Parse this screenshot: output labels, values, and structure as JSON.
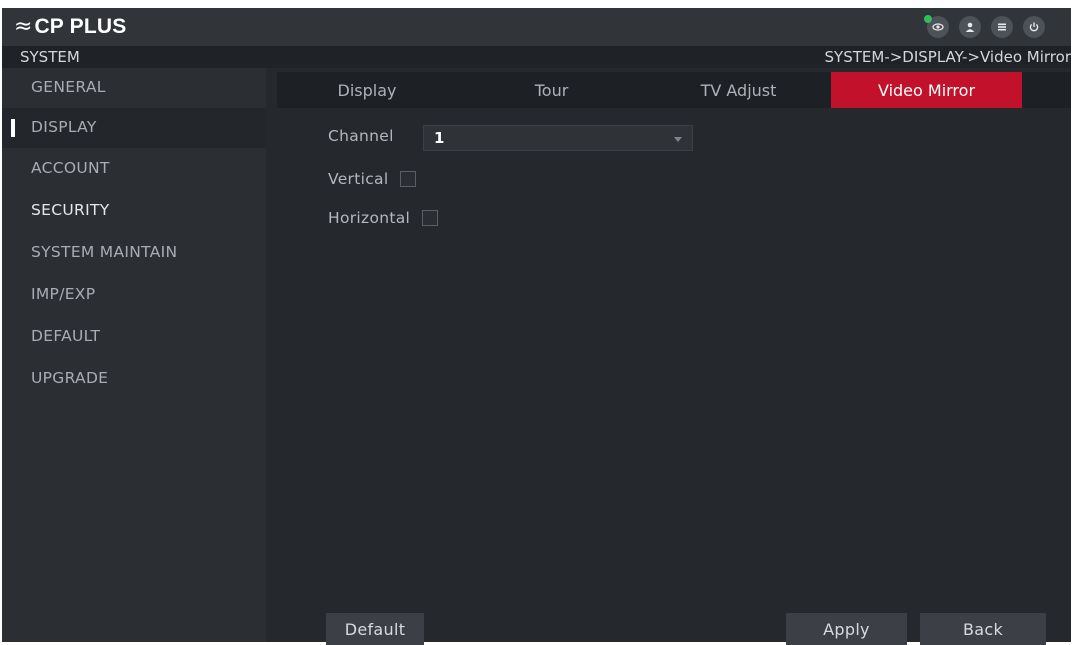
{
  "header": {
    "logo_text": "CP PLUS",
    "icons": [
      "live-view-icon",
      "user-icon",
      "menu-icon",
      "power-icon"
    ]
  },
  "pathbar": {
    "section": "SYSTEM",
    "breadcrumb": "SYSTEM->DISPLAY->Video Mirror"
  },
  "sidebar": {
    "items": [
      {
        "label": "GENERAL"
      },
      {
        "label": "DISPLAY",
        "active": true
      },
      {
        "label": "ACCOUNT"
      },
      {
        "label": "SECURITY"
      },
      {
        "label": "SYSTEM MAINTAIN"
      },
      {
        "label": "IMP/EXP"
      },
      {
        "label": "DEFAULT"
      },
      {
        "label": "UPGRADE"
      }
    ]
  },
  "tabs": [
    {
      "label": "Display"
    },
    {
      "label": "Tour"
    },
    {
      "label": "TV Adjust"
    },
    {
      "label": "Video Mirror",
      "active": true
    }
  ],
  "form": {
    "channel_label": "Channel",
    "channel_value": "1",
    "vertical_label": "Vertical",
    "vertical_checked": false,
    "horizontal_label": "Horizontal",
    "horizontal_checked": false
  },
  "buttons": {
    "default_label": "Default",
    "apply_label": "Apply",
    "back_label": "Back"
  },
  "colors": {
    "accent": "#c2122b",
    "background": "#25282c",
    "sidebar": "#2b2f34",
    "live_indicator": "#2fbf55"
  }
}
